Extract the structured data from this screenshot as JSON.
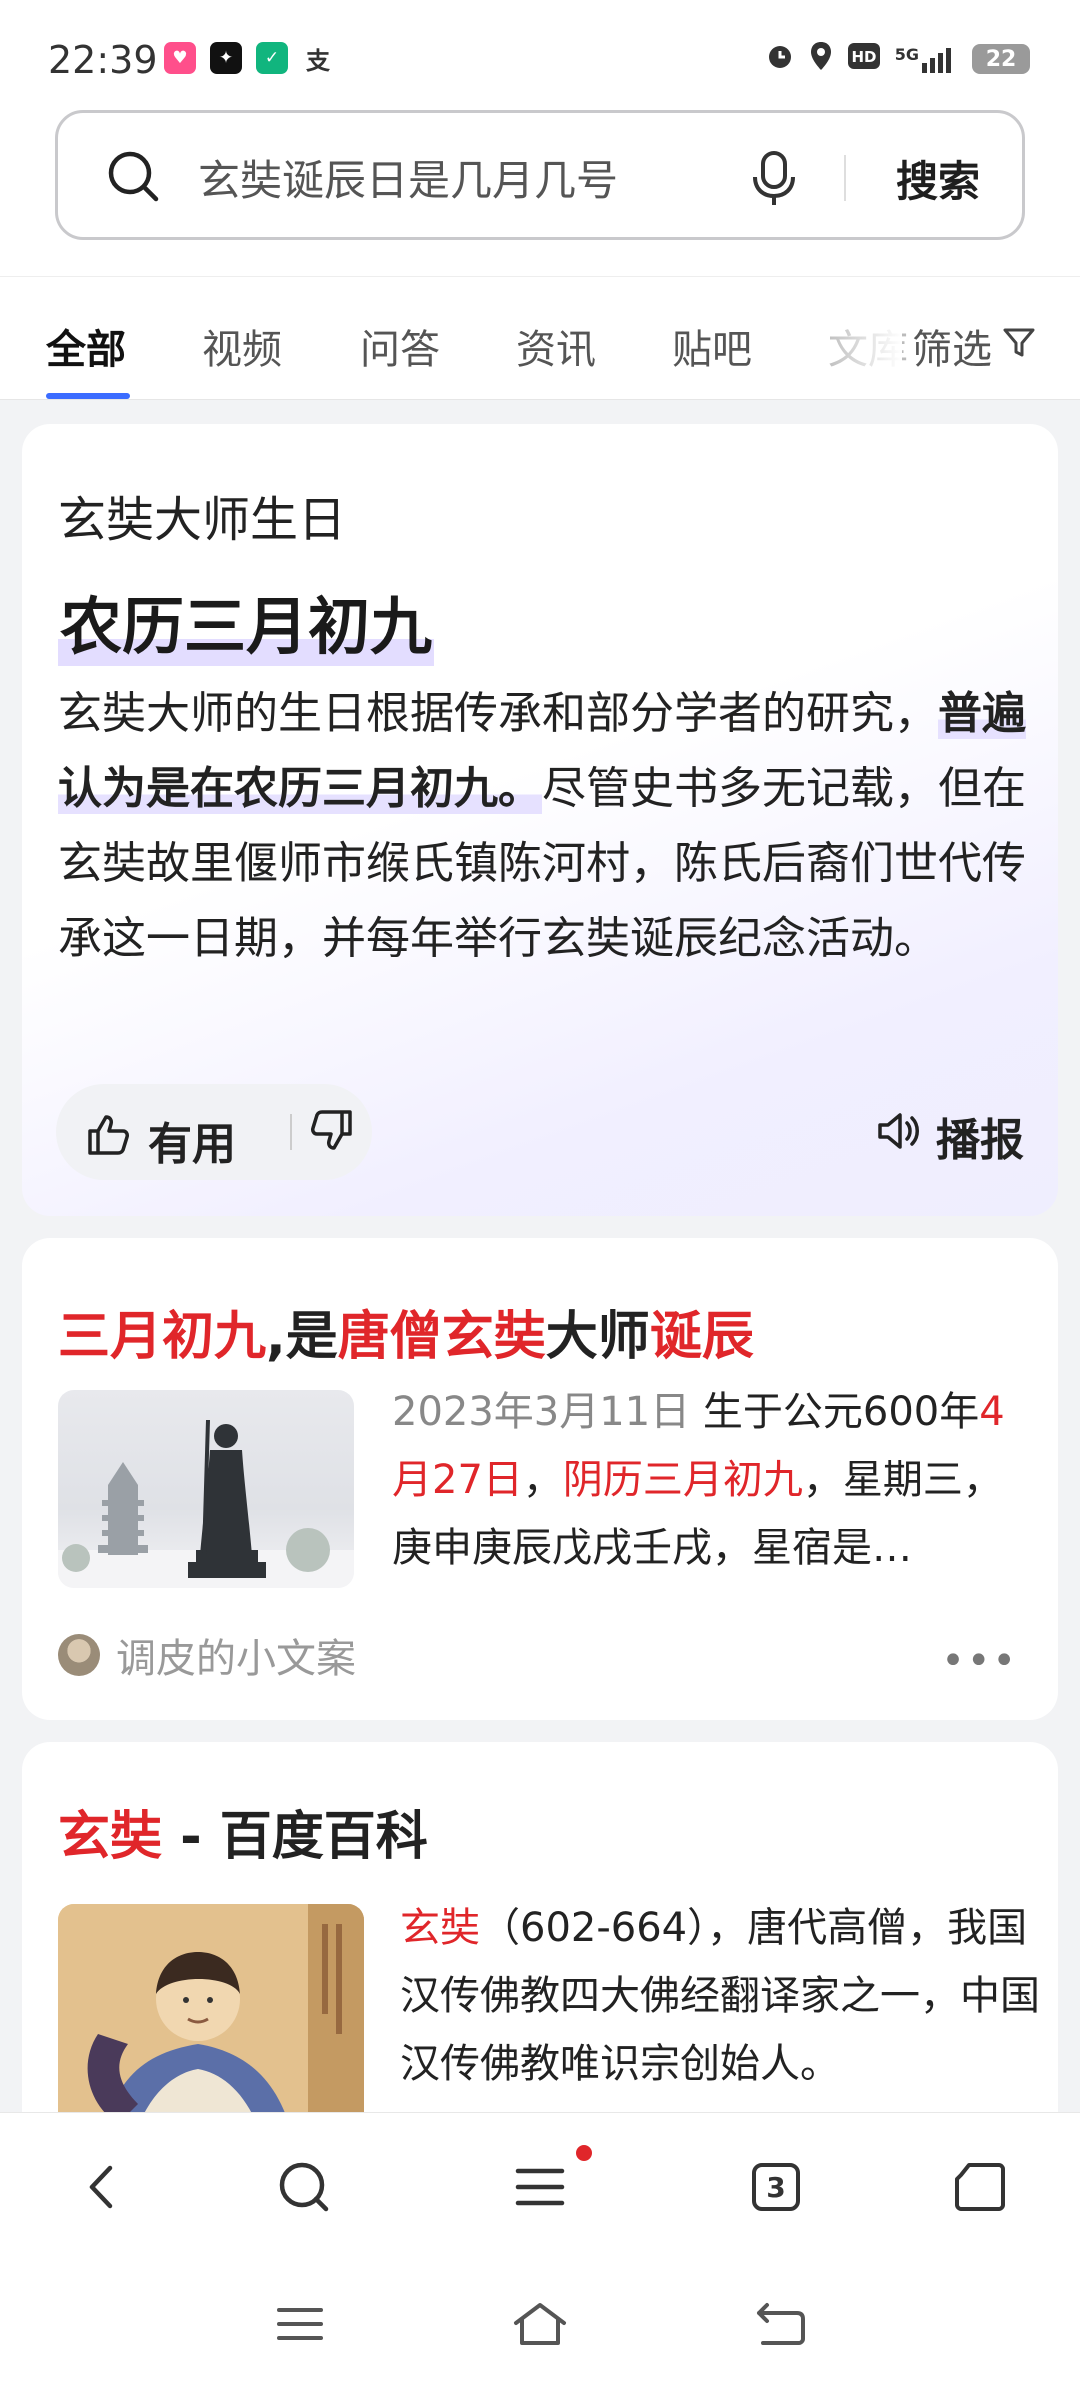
{
  "status": {
    "time": "22:39",
    "network": "5G",
    "battery": "22"
  },
  "search": {
    "query": "玄奘诞辰日是几月几号",
    "button_label": "搜索"
  },
  "tabs": [
    {
      "label": "全部",
      "active": true
    },
    {
      "label": "视频",
      "active": false
    },
    {
      "label": "问答",
      "active": false
    },
    {
      "label": "资讯",
      "active": false
    },
    {
      "label": "贴吧",
      "active": false
    },
    {
      "label": "文库",
      "active": false
    }
  ],
  "filter_label": "筛选",
  "answer_card": {
    "kicker": "玄奘大师生日",
    "answer": "农历三月初九",
    "body_pre": "玄奘大师的生日根据传承和部分学者的研究，",
    "body_highlight": "普遍认为是在农历三月初九。",
    "body_post": "尽管史书多无记载，但在玄奘故里偃师市缑氏镇陈河村，陈氏后裔们世代传承这一日期，并每年举行玄奘诞辰纪念活动。",
    "useful_label": "有用",
    "broadcast_label": "播报"
  },
  "result1": {
    "title_parts": [
      "三月初九",
      ",是",
      "唐僧玄奘",
      "大师",
      "诞辰"
    ],
    "date": "2023年3月11日",
    "text_a": "生于公元600年",
    "text_b": "4月27日",
    "text_c": "，",
    "text_d": "阴历三月初九",
    "text_e": "，星期三，庚申庚辰戊戌壬戌，星宿是…",
    "source": "调皮的小文案",
    "more": "•••"
  },
  "result2": {
    "title_red": "玄奘",
    "title_rest": " - 百度百科",
    "text_red": "玄奘",
    "text_rest": "（602-664），唐代高僧，我国汉传佛教四大佛经翻译家之一，中国汉传佛教唯识宗创始人。"
  },
  "bottom_nav": {
    "tabs_count": "3"
  },
  "colors": {
    "accent": "#3b6cff",
    "highlight_red": "#e0262a"
  }
}
